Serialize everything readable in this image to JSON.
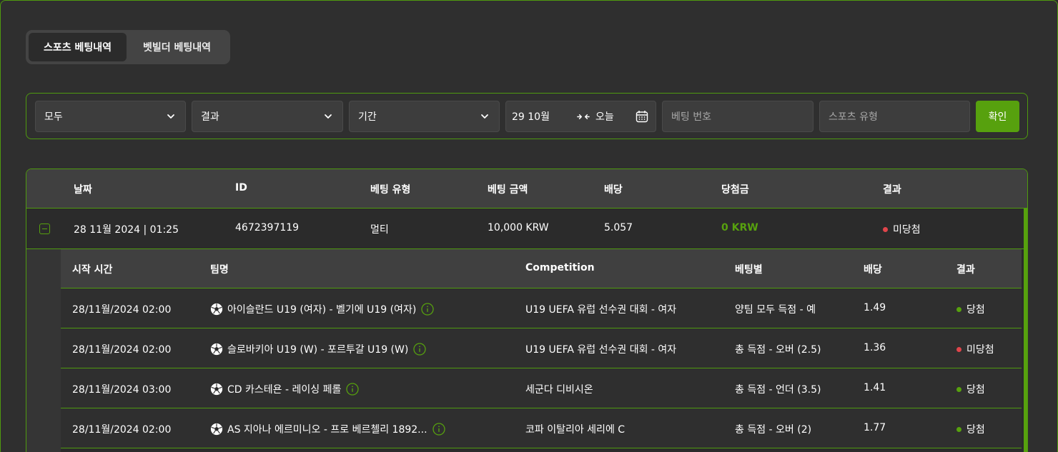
{
  "tabs": [
    {
      "label": "스포츠 베팅내역",
      "active": true
    },
    {
      "label": "벳빌더 베팅내역",
      "active": false
    }
  ],
  "filters": {
    "type_select": "모두",
    "result_select": "결과",
    "period_select": "기간",
    "date_from": "29 10월",
    "date_to": "오늘",
    "bet_number_placeholder": "베팅 번호",
    "sport_type_placeholder": "스포츠 유형",
    "confirm_label": "확인"
  },
  "table": {
    "headers": [
      "날짜",
      "ID",
      "베팅 유형",
      "베팅 금액",
      "배당",
      "당첨금",
      "결과"
    ],
    "row": {
      "date": "28 11월 2024 | 01:25",
      "id": "4672397119",
      "bet_type": "멀티",
      "amount": "10,000 KRW",
      "odds": "5.057",
      "winnings": "0 KRW",
      "result": "미당첨"
    },
    "sub_headers": [
      "시작 시간",
      "팀명",
      "Competition",
      "베팅별",
      "배당",
      "결과"
    ],
    "sub_rows": [
      {
        "start": "28/11월/2024 02:00",
        "teams": "아이슬란드 U19 (여자) - 벨기에 U19 (여자)",
        "competition": "U19 UEFA 유럽 선수권 대회 - 여자",
        "selection": "양팀 모두 득점 - 예",
        "odds": "1.49",
        "result": "당첨",
        "result_status": "won"
      },
      {
        "start": "28/11월/2024 02:00",
        "teams": "슬로바키아 U19 (W) - 포르투갈 U19 (W)",
        "competition": "U19 UEFA 유럽 선수권 대회 - 여자",
        "selection": "총 득점 - 오버 (2.5)",
        "odds": "1.36",
        "result": "미당첨",
        "result_status": "lost"
      },
      {
        "start": "28/11월/2024 03:00",
        "teams": "CD 카스테욘 - 레이싱 페롤",
        "competition": "세군다 디비시온",
        "selection": "총 득점 - 언더 (3.5)",
        "odds": "1.41",
        "result": "당첨",
        "result_status": "won"
      },
      {
        "start": "28/11월/2024 02:00",
        "teams": "AS 지아나 에르미니오 - 프로 베르첼리 1892...",
        "competition": "코파 이탈리아 세리에 C",
        "selection": "총 득점 - 오버 (2)",
        "odds": "1.77",
        "result": "당첨",
        "result_status": "won"
      }
    ]
  },
  "colors": {
    "accent": "#57a10e",
    "lost": "#e0454b",
    "background": "#2f2f2f"
  }
}
